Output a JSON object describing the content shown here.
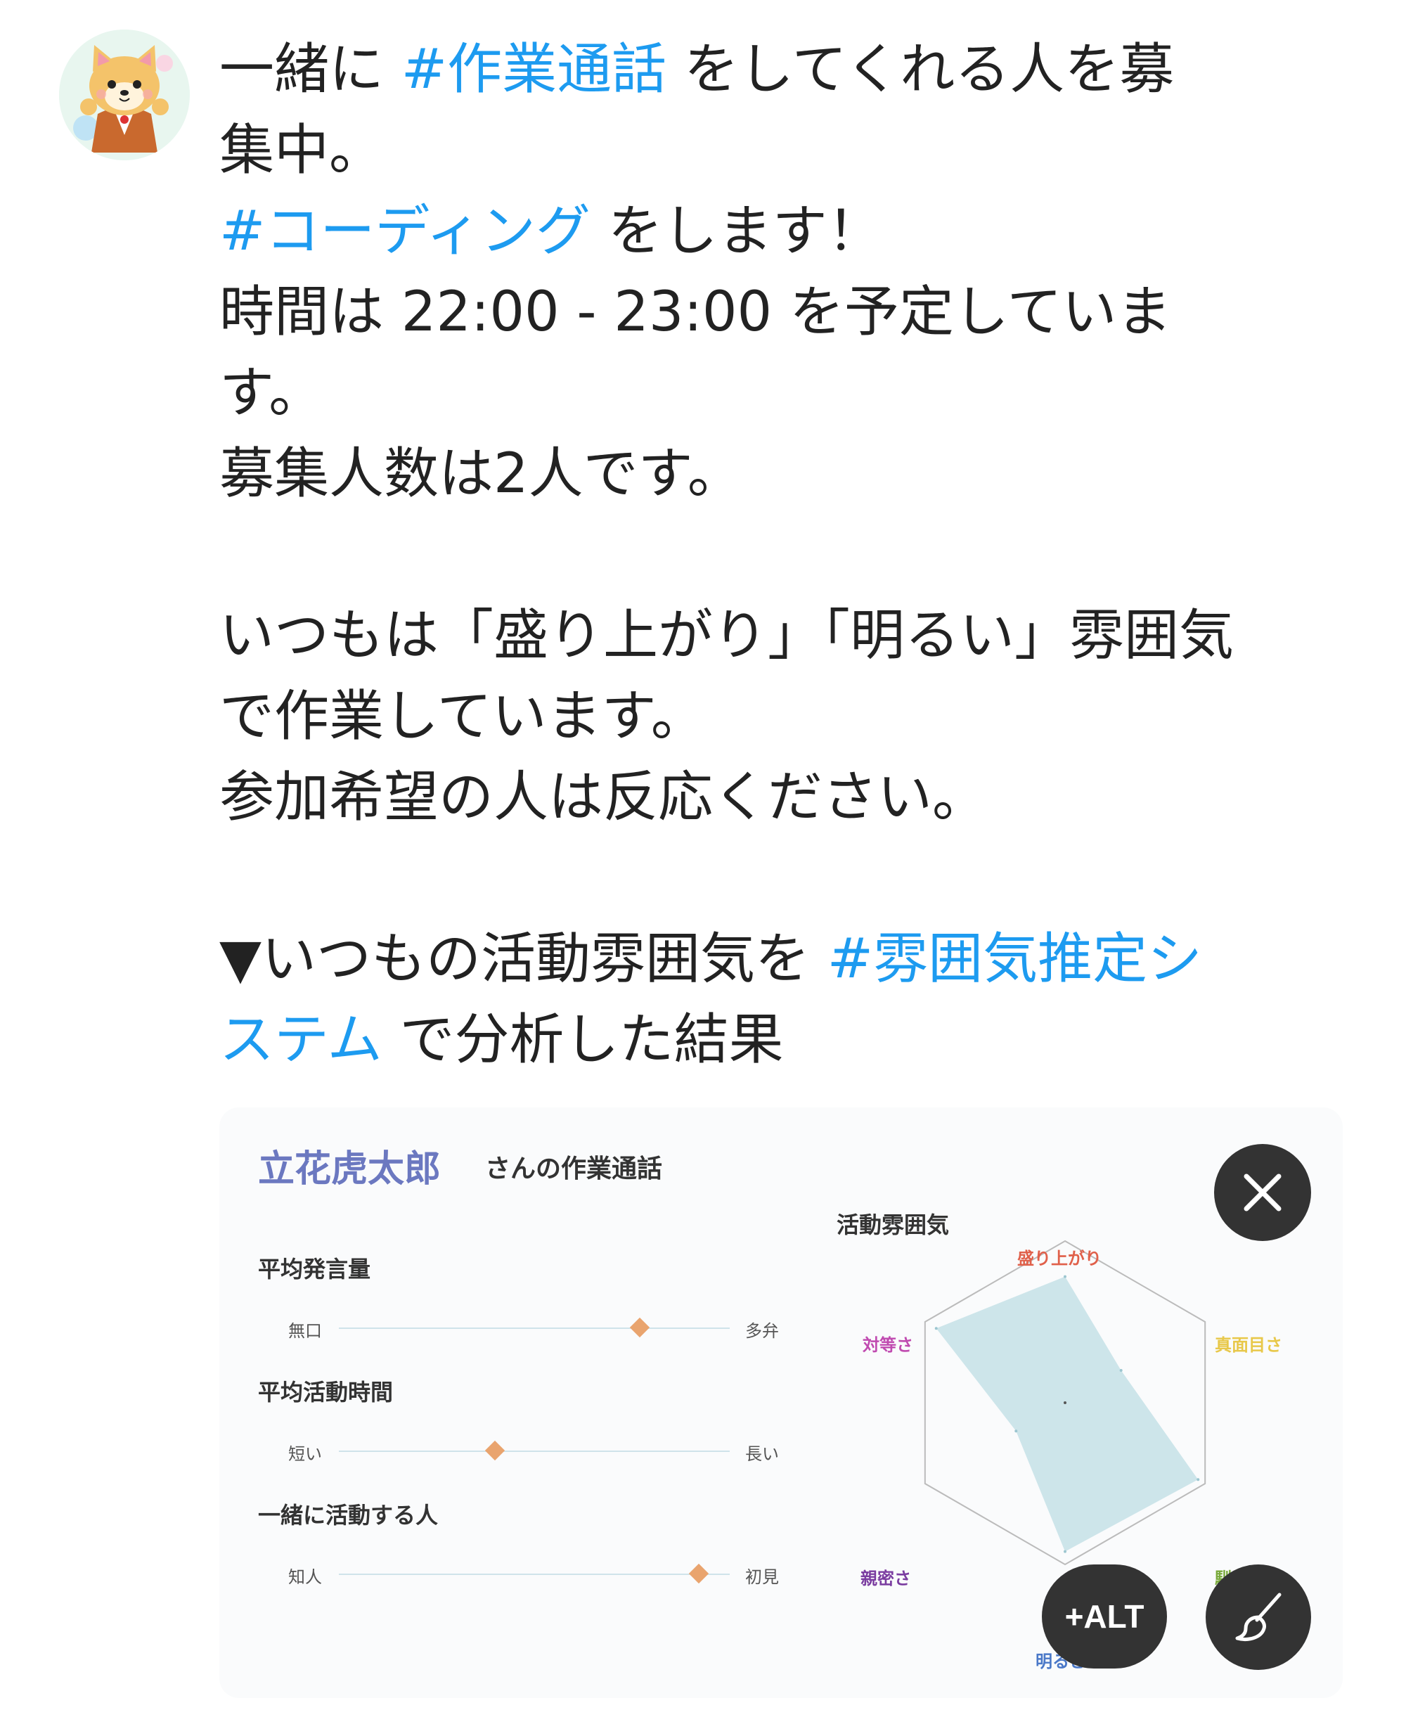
{
  "post": {
    "line1_pre": "一緒に ",
    "line1_tag": "#作業通話",
    "line1_post": " をしてくれる人を募",
    "line2": "集中。",
    "line3_tag": "#コーディング",
    "line3_post": " をします！",
    "line4": "時間は 22:00 - 23:00 を予定していま",
    "line5": "す。",
    "line6": "募集人数は2人です。",
    "line7": "",
    "line8": "いつもは「盛り上がり」「明るい」雰囲気",
    "line9": "で作業しています。",
    "line10": "参加希望の人は反応ください。",
    "line11": "",
    "line12_pre": "▼いつもの活動雰囲気を ",
    "line12_tag": "#雰囲気推定シ",
    "line13_tag": "ステム",
    "line13_post": " で分析した結果"
  },
  "card": {
    "title_name": "立花虎太郎",
    "title_rest": "さんの作業通話",
    "metrics": [
      {
        "label": "平均発言量",
        "left": "無口",
        "right": "多弁",
        "value": 0.77
      },
      {
        "label": "平均活動時間",
        "left": "短い",
        "right": "長い",
        "value": 0.4
      },
      {
        "label": "一緒に活動する人",
        "left": "知人",
        "right": "初見",
        "value": 0.92
      }
    ],
    "chart_title": "活動雰囲気"
  },
  "chart_data": {
    "type": "radar",
    "axes": [
      "盛り上がり",
      "真面目さ",
      "馴れ合い",
      "明るさ",
      "親密さ",
      "対等さ"
    ],
    "axis_colors": [
      "#e0604a",
      "#e8c84a",
      "#7aaa3c",
      "#4a78c8",
      "#7a3ca0",
      "#c04ab0"
    ],
    "values": [
      0.78,
      0.4,
      0.95,
      0.92,
      0.35,
      0.92
    ],
    "fill_color": "#cde5ea",
    "grid": true
  },
  "buttons": {
    "close_icon": "close-icon",
    "alt_label": "+ALT",
    "edit_icon": "brush-icon"
  },
  "colors": {
    "hashtag": "#1d9bf0",
    "card_name": "#6b78c0",
    "marker": "#e9a46e"
  }
}
